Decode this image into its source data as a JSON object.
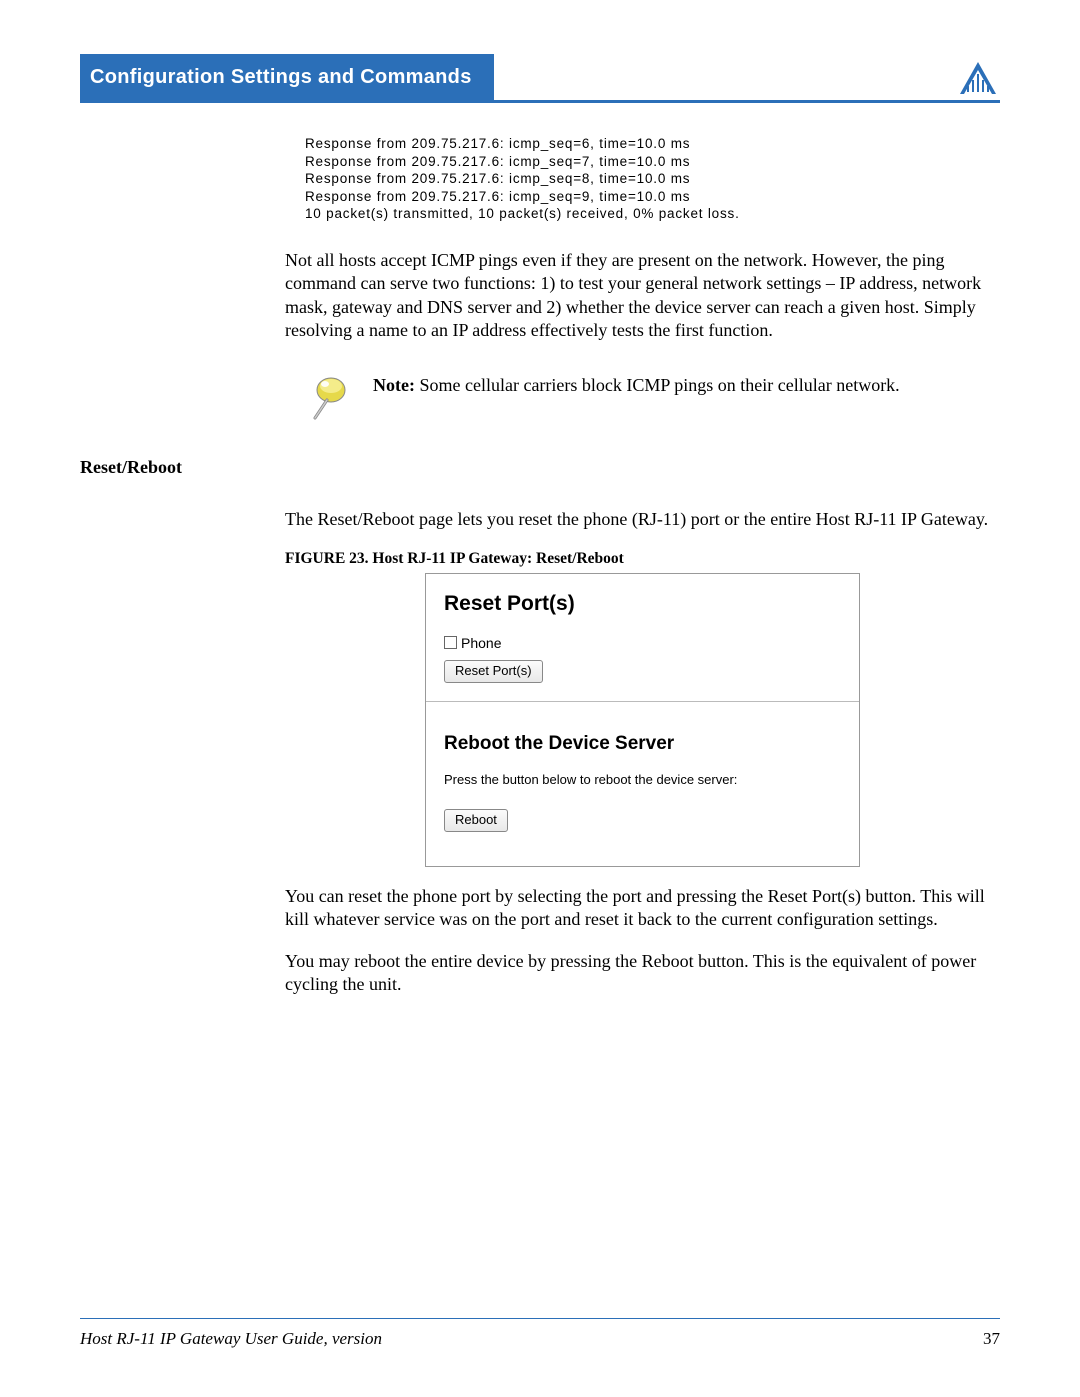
{
  "header": {
    "title": "Configuration Settings and Commands"
  },
  "code": {
    "line1": "Response from 209.75.217.6: icmp_seq=6, time=10.0 ms",
    "line2": "Response from 209.75.217.6: icmp_seq=7, time=10.0 ms",
    "line3": "Response from 209.75.217.6: icmp_seq=8, time=10.0 ms",
    "line4": "Response from 209.75.217.6: icmp_seq=9, time=10.0 ms",
    "line5": "10 packet(s) transmitted, 10 packet(s) received, 0% packet loss."
  },
  "para1": "Not all hosts accept ICMP pings even if they are present on the network. However, the ping command can serve two functions: 1) to test your general network settings – IP address, network mask, gateway and DNS server and 2) whether the device server can reach a given host. Simply resolving a name to an IP address effectively tests the first function.",
  "note": {
    "label": "Note:",
    "text": " Some cellular carriers block ICMP pings on their cellular network."
  },
  "section_heading": "Reset/Reboot",
  "para2": "The Reset/Reboot page lets you reset the phone (RJ-11) port or the entire Host RJ-11 IP Gateway.",
  "figure": {
    "caption": "FIGURE 23.  Host RJ-11 IP Gateway: Reset/Reboot",
    "heading1": "Reset Port(s)",
    "checkbox_label": "Phone",
    "button1": "Reset Port(s)",
    "heading2": "Reboot the Device Server",
    "subtext": "Press the button below to reboot the device server:",
    "button2": "Reboot"
  },
  "para3": "You can reset the phone port by selecting the port and pressing the Reset Port(s) button. This will kill whatever service was on the port and reset it back to the current configuration settings.",
  "para4": "You may reboot the entire device by pressing the Reboot button. This is the equivalent of power cycling the unit.",
  "footer": {
    "left": "Host RJ-11 IP Gateway User Guide, version",
    "right": "37"
  }
}
